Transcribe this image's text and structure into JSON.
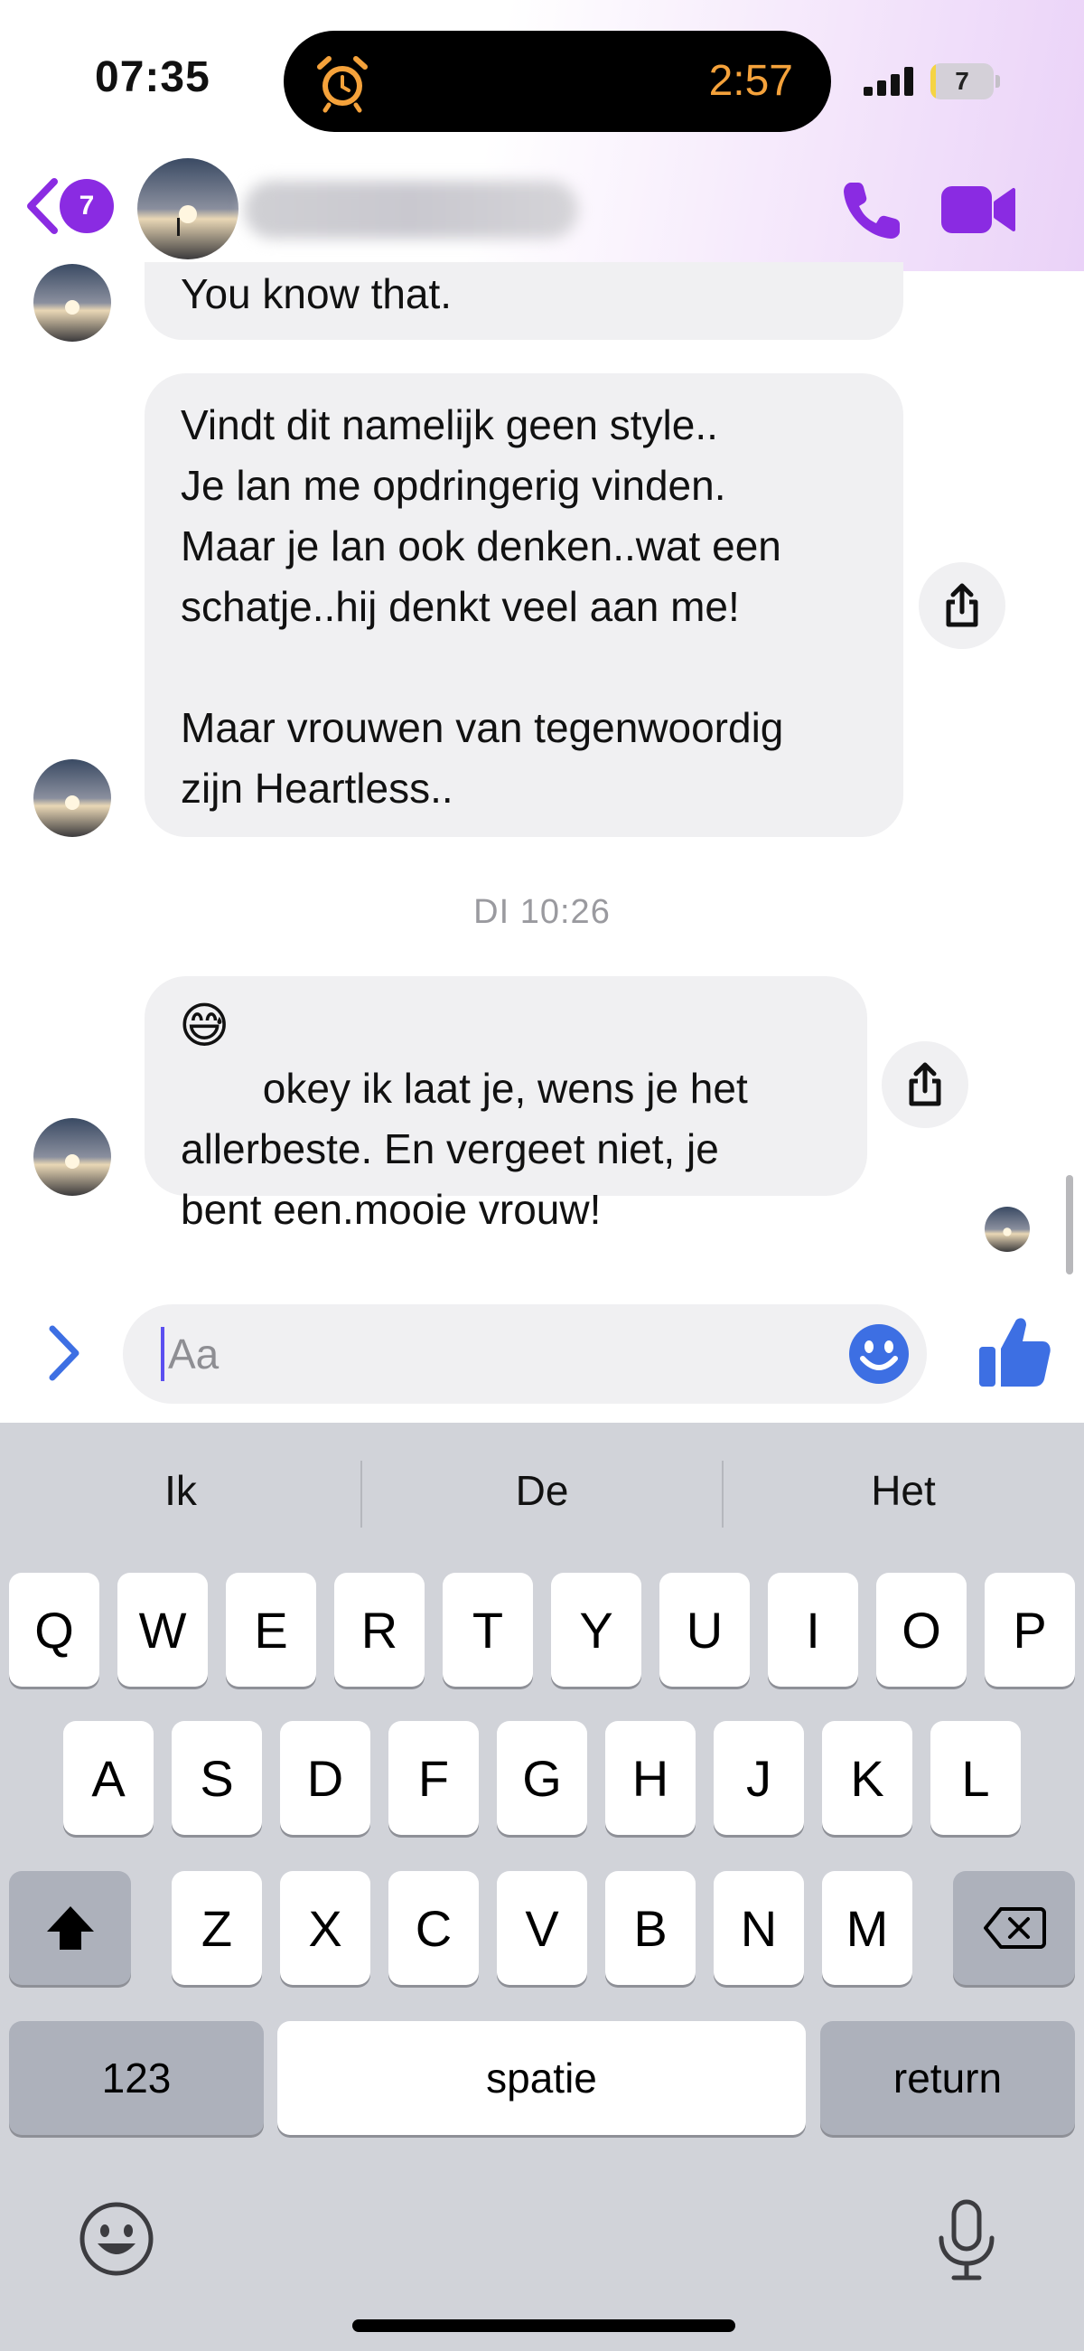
{
  "status_bar": {
    "time": "07:35",
    "timer": "2:57",
    "battery": "7",
    "battery_fraction": 0.07
  },
  "header": {
    "back_badge_count": "7",
    "icons": [
      "back-chevron-icon",
      "phone-icon",
      "video-camera-icon"
    ]
  },
  "messages": [
    {
      "text": "You know that."
    },
    {
      "text": "Vindt dit namelijk geen style..\nJe lan me opdringerig vinden.\nMaar je lan ook denken..wat een\nschatje..hij denkt veel aan me!\n\nMaar vrouwen van tegenwoordig\nzijn Heartless.."
    },
    {
      "emoji": "😅",
      "text": " okey ik laat je,   wens je het\nallerbeste.  En vergeet niet,  je\nbent een.mooie vrouw!"
    }
  ],
  "timestamp": "DI 10:26",
  "composer": {
    "placeholder": "Aa",
    "icons": [
      "chevron-right-icon",
      "smiley-icon",
      "thumbs-up-icon"
    ]
  },
  "keyboard": {
    "suggestions": [
      "Ik",
      "De",
      "Het"
    ],
    "row1": [
      "Q",
      "W",
      "E",
      "R",
      "T",
      "Y",
      "U",
      "I",
      "O",
      "P"
    ],
    "row2": [
      "A",
      "S",
      "D",
      "F",
      "G",
      "H",
      "J",
      "K",
      "L"
    ],
    "row3": [
      "Z",
      "X",
      "C",
      "V",
      "B",
      "N",
      "M"
    ],
    "numbers_key": "123",
    "space_key": "spatie",
    "return_key": "return"
  },
  "colors": {
    "accent": "#8a2be2",
    "blue_accent": "#3d6fe3",
    "bubble": "#f0f0f2",
    "keyboard_bg": "#d1d3d9"
  }
}
